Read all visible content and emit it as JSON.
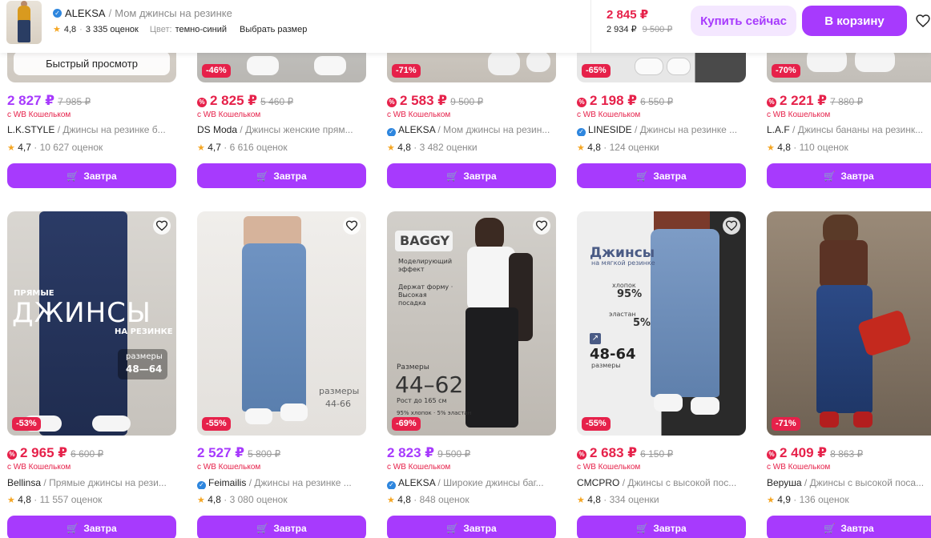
{
  "topbar": {
    "brand": "ALEKSA",
    "separator": "/",
    "title": "Мом джинсы на резинке",
    "rating": "4,8",
    "dot": "·",
    "reviews": "3 335 оценок",
    "color_label": "Цвет:",
    "color_value": "темно-синий",
    "size_link": "Выбрать размер",
    "price": "2 845 ₽",
    "wallet_price": "2 934 ₽",
    "old_price": "9 500 ₽",
    "buy_now": "Купить сейчас",
    "add_to_cart": "В корзину"
  },
  "common": {
    "quick_view": "Быстрый просмотр",
    "wallet_label": "с WB Кошельком",
    "deliver_label": "Завтра",
    "separator": "/",
    "dot": "·"
  },
  "row1": [
    {
      "price": "2 827 ₽",
      "old_price": "7 985 ₽",
      "price_color": "purple",
      "sale_icon": false,
      "brand": "L.K.STYLE",
      "verified": false,
      "desc": "Джинсы на резинке б...",
      "rating": "4,7",
      "reviews": "10 627 оценок",
      "badge": ""
    },
    {
      "price": "2 825 ₽",
      "old_price": "5 460 ₽",
      "price_color": "red",
      "sale_icon": true,
      "brand": "DS Moda",
      "verified": false,
      "desc": "Джинсы женские прям...",
      "rating": "4,7",
      "reviews": "6 616 оценок",
      "badge": "-46%"
    },
    {
      "price": "2 583 ₽",
      "old_price": "9 500 ₽",
      "price_color": "red",
      "sale_icon": true,
      "brand": "ALEKSA",
      "verified": true,
      "desc": "Мом джинсы на резин...",
      "rating": "4,8",
      "reviews": "3 482 оценки",
      "badge": "-71%"
    },
    {
      "price": "2 198 ₽",
      "old_price": "6 550 ₽",
      "price_color": "red",
      "sale_icon": true,
      "brand": "LINESIDE",
      "verified": true,
      "desc": "Джинсы на резинке ...",
      "rating": "4,8",
      "reviews": "124 оценки",
      "badge": "-65%"
    },
    {
      "price": "2 221 ₽",
      "old_price": "7 880 ₽",
      "price_color": "red",
      "sale_icon": true,
      "brand": "L.A.F",
      "verified": false,
      "desc": "Джинсы бананы на резинк...",
      "rating": "4,8",
      "reviews": "110 оценок",
      "badge": "-70%"
    }
  ],
  "row2": [
    {
      "price": "2 965 ₽",
      "old_price": "6 600 ₽",
      "price_color": "red",
      "sale_icon": true,
      "brand": "Bellinsa",
      "verified": false,
      "desc": "Прямые джинсы на рези...",
      "rating": "4,8",
      "reviews": "11 557 оценок",
      "badge": "-53%"
    },
    {
      "price": "2 527 ₽",
      "old_price": "5 800 ₽",
      "price_color": "purple",
      "sale_icon": false,
      "brand": "Feimailis",
      "verified": true,
      "desc": "Джинсы на резинке ...",
      "rating": "4,8",
      "reviews": "3 080 оценок",
      "badge": "-55%"
    },
    {
      "price": "2 823 ₽",
      "old_price": "9 500 ₽",
      "price_color": "purple",
      "sale_icon": false,
      "brand": "ALEKSA",
      "verified": true,
      "desc": "Широкие джинсы баг...",
      "rating": "4,8",
      "reviews": "848 оценок",
      "badge": "-69%"
    },
    {
      "price": "2 683 ₽",
      "old_price": "6 150 ₽",
      "price_color": "red",
      "sale_icon": true,
      "brand": "CMCPRO",
      "verified": false,
      "desc": "Джинсы с высокой пос...",
      "rating": "4,8",
      "reviews": "334 оценки",
      "badge": "-55%"
    },
    {
      "price": "2 409 ₽",
      "old_price": "8 863 ₽",
      "price_color": "red",
      "sale_icon": true,
      "brand": "Веруша",
      "verified": false,
      "desc": "Джинсы с высокой поса...",
      "rating": "4,9",
      "reviews": "136 оценок",
      "badge": "-71%"
    }
  ],
  "image_text": {
    "bellinsa_line1": "ПРЯМЫЕ",
    "bellinsa_line2": "ДЖИНСЫ",
    "bellinsa_line3": "НА РЕЗИНКЕ",
    "bellinsa_sizes_label": "размеры",
    "bellinsa_sizes": "48—64",
    "feimailis_sizes_label": "размеры",
    "feimailis_sizes": "44-66",
    "aleksa_baggy": "BAGGY",
    "aleksa_feature1": "Моделирующий эффект",
    "aleksa_feature2": "Держат форму · Высокая посадка",
    "aleksa_sizes_label": "Размеры",
    "aleksa_sizes": "44–62",
    "aleksa_height": "Рост до 165 см",
    "aleksa_fabric": "95% хлопок · 5% эластан",
    "cmc_title": "Джинсы",
    "cmc_subtitle": "на мягкой резинке",
    "cmc_cotton_label": "хлопок",
    "cmc_cotton": "95%",
    "cmc_elastane_label": "эластан",
    "cmc_elastane": "5%",
    "cmc_sizes": "48-64",
    "cmc_sizes_label": "размеры"
  },
  "colors": {
    "accent": "#a73afd",
    "sale_red": "#e6214a",
    "star": "#f5a623",
    "muted": "#8b8b8b"
  }
}
